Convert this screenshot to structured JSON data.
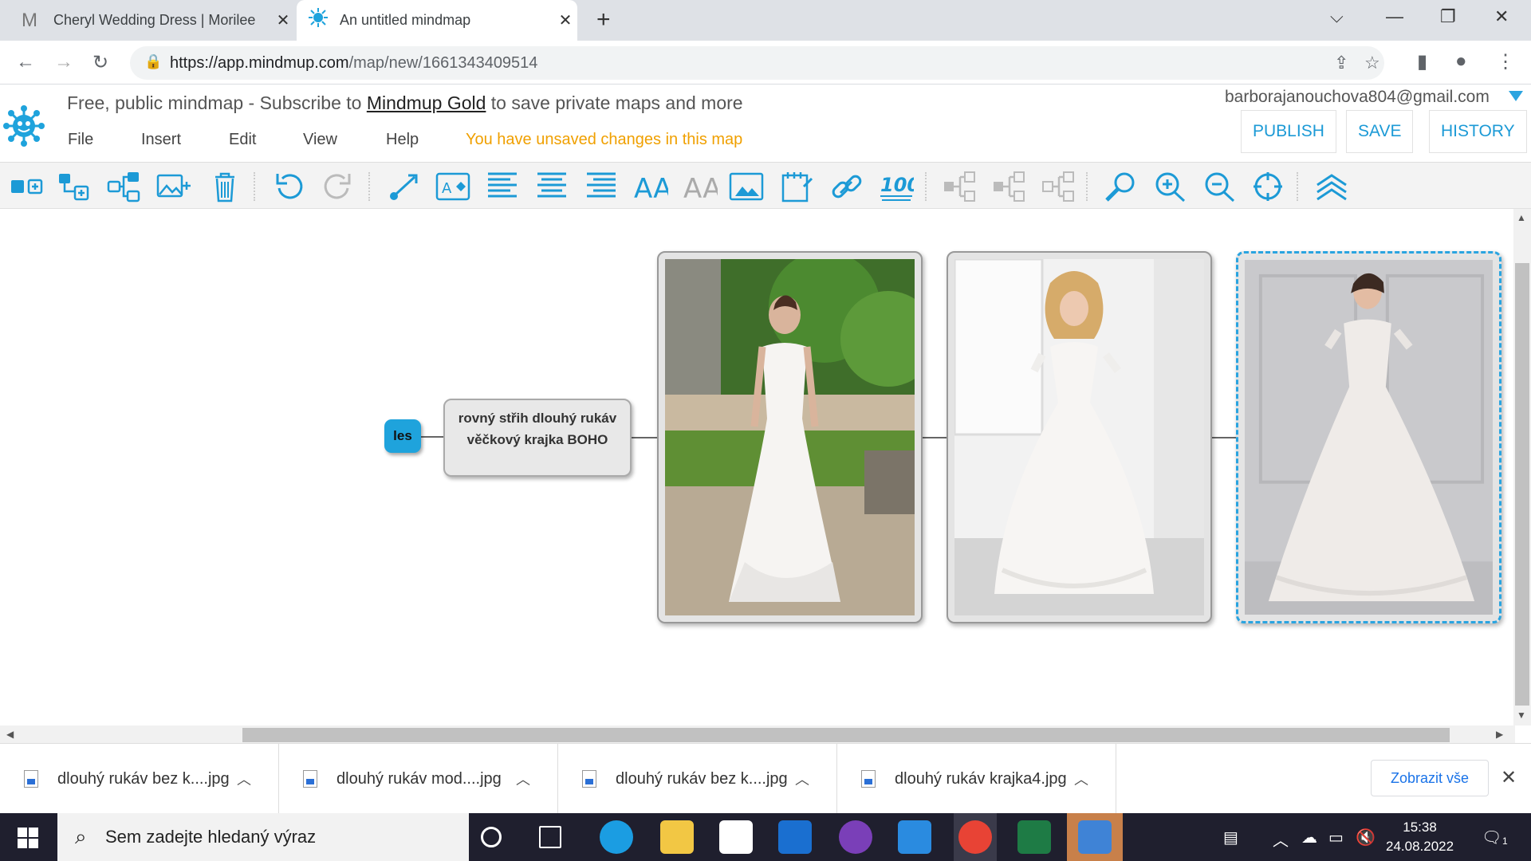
{
  "browser": {
    "tabs": [
      {
        "title": "Cheryl Wedding Dress | Morilee",
        "favicon": "M"
      },
      {
        "title": "An untitled mindmap",
        "favicon": "mindmup-icon"
      }
    ],
    "url_host": "https://app.mindmup.com",
    "url_path": "/map/new/1661343409514"
  },
  "app": {
    "promo_prefix": "Free, public mindmap - Subscribe to ",
    "promo_link": "Mindmup Gold",
    "promo_suffix": " to save private maps and more",
    "menu": [
      "File",
      "Insert",
      "Edit",
      "View",
      "Help"
    ],
    "unsaved": "You have unsaved changes in this map",
    "email": "barborajanouchova804@gmail.com",
    "buttons": {
      "publish": "PUBLISH",
      "save": "SAVE",
      "history": "HISTORY"
    },
    "accent": "#1c9ad6"
  },
  "map": {
    "root_label": "les",
    "text_node": "rovný střih dlouhý rukáv věčkový krajka BOHO",
    "image_nodes": 3
  },
  "downloads": {
    "items": [
      "dlouhý rukáv bez k....jpg",
      "dlouhý rukáv mod....jpg",
      "dlouhý rukáv bez k....jpg",
      "dlouhý rukáv krajka4.jpg"
    ],
    "show_all": "Zobrazit vše"
  },
  "taskbar": {
    "search_placeholder": "Sem zadejte hledaný výraz",
    "time": "15:38",
    "date": "24.08.2022",
    "notifications": "1"
  }
}
